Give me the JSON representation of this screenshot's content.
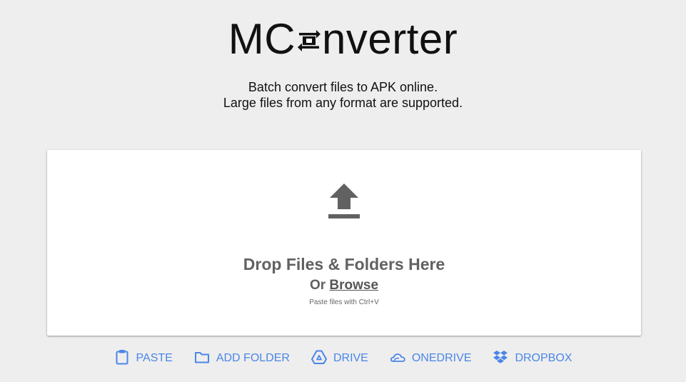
{
  "logo": {
    "prefix": "MC",
    "icon": "swap-arrows-icon",
    "suffix": "nverter"
  },
  "tagline": {
    "line1": "Batch convert files to APK online.",
    "line2": "Large files from any format are supported."
  },
  "dropzone": {
    "icon": "upload-icon",
    "title": "Drop Files & Folders Here",
    "or_text": "Or ",
    "browse_label": "Browse",
    "paste_hint": "Paste files with Ctrl+V"
  },
  "sources": [
    {
      "label": "PASTE",
      "icon": "clipboard-icon"
    },
    {
      "label": "ADD FOLDER",
      "icon": "folder-icon"
    },
    {
      "label": "DRIVE",
      "icon": "google-drive-icon"
    },
    {
      "label": "ONEDRIVE",
      "icon": "onedrive-icon"
    },
    {
      "label": "DROPBOX",
      "icon": "dropbox-icon"
    }
  ],
  "colors": {
    "background": "#eeeeee",
    "accent": "#4a86e8",
    "drop_text": "#616161"
  }
}
